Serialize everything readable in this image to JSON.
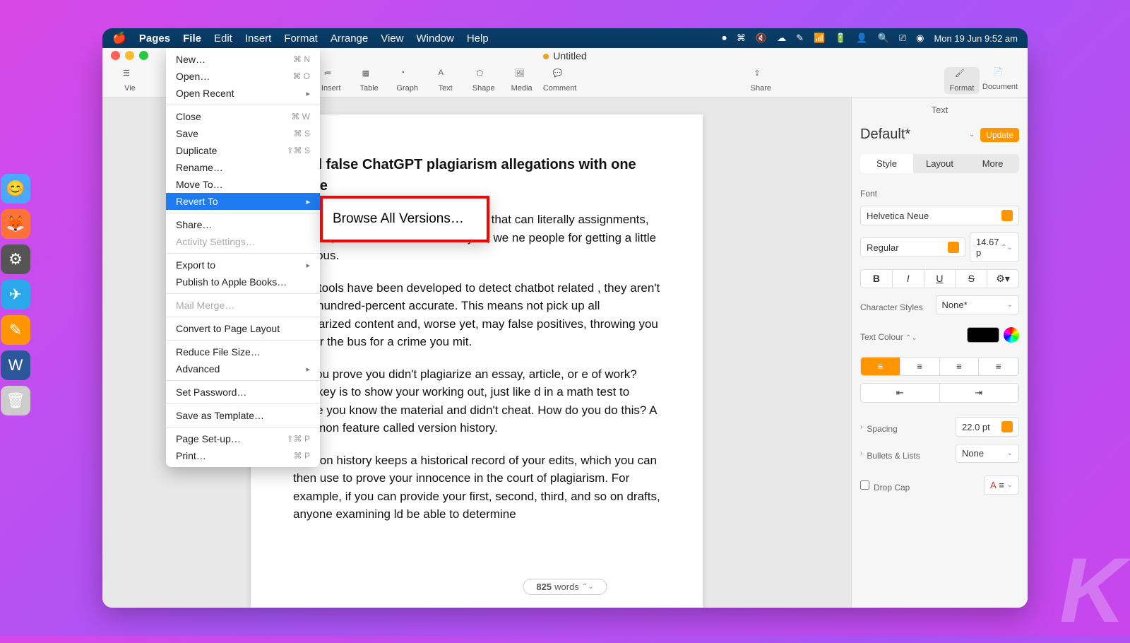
{
  "menubar": {
    "app": "Pages",
    "items": [
      "File",
      "Edit",
      "Insert",
      "Format",
      "Arrange",
      "View",
      "Window",
      "Help"
    ],
    "datetime": "Mon 19 Jun  9:52 am"
  },
  "dock": [
    "finder",
    "firefox",
    "settings",
    "telegram",
    "pages",
    "word",
    "trash"
  ],
  "window": {
    "title": "Untitled",
    "view_label": "Vie"
  },
  "toolbar": {
    "insert": "Insert",
    "table": "Table",
    "graph": "Graph",
    "text": "Text",
    "shape": "Shape",
    "media": "Media",
    "comment": "Comment",
    "share": "Share",
    "format": "Format",
    "document": "Document"
  },
  "file_menu": {
    "new": "New…",
    "new_sc": "⌘ N",
    "open": "Open…",
    "open_sc": "⌘ O",
    "open_recent": "Open Recent",
    "close": "Close",
    "close_sc": "⌘ W",
    "save": "Save",
    "save_sc": "⌘ S",
    "duplicate": "Duplicate",
    "dup_sc": "⇧⌘ S",
    "rename": "Rename…",
    "move": "Move To…",
    "revert": "Revert To",
    "share": "Share…",
    "activity": "Activity Settings…",
    "export": "Export to",
    "publish": "Publish to Apple Books…",
    "mailmerge": "Mail Merge…",
    "convert": "Convert to Page Layout",
    "reduce": "Reduce File Size…",
    "advanced": "Advanced",
    "password": "Set Password…",
    "template": "Save as Template…",
    "pagesetup": "Page Set-up…",
    "pagesetup_sc": "⇧⌘ P",
    "print": "Print…",
    "print_sc": "⌘ P"
  },
  "submenu": {
    "browse": "Browse All Versions…"
  },
  "document": {
    "heading": "void false ChatGPT plagiarism allegations with one ature",
    "p1": "ise of AI chatbots, such as ChatGPT, that can literally assignments, articles, or even entire books for you, we ne people for getting a little nervous.",
    "p2": "tiple tools have been developed to detect chatbot related , they aren't one-hundred-percent accurate. This means not pick up all plagiarized content and, worse yet, may false positives, throwing you under the bus for a crime you mit.",
    "p3": "an you prove you didn't plagiarize an essay, article, or e of work? The key is to show your working out, just like d in a math test to prove you know the material and didn't cheat. How do you do this? A common feature called version history.",
    "p4": "Version history keeps a historical record of your edits, which you can then use to prove your innocence in the court of plagiarism. For example, if you can provide your first, second, third, and so on drafts, anyone examining                      ld be able to determine",
    "word_count": "825",
    "word_label": "words"
  },
  "inspector": {
    "tab": "Text",
    "style_name": "Default*",
    "update": "Update",
    "tabs": {
      "style": "Style",
      "layout": "Layout",
      "more": "More"
    },
    "font_label": "Font",
    "font": "Helvetica Neue",
    "weight": "Regular",
    "size": "14.67 p",
    "char_styles_label": "Character Styles",
    "char_styles": "None*",
    "text_color_label": "Text Colour",
    "spacing_label": "Spacing",
    "spacing": "22.0 pt",
    "bullets_label": "Bullets & Lists",
    "bullets": "None",
    "dropcap_label": "Drop Cap"
  }
}
